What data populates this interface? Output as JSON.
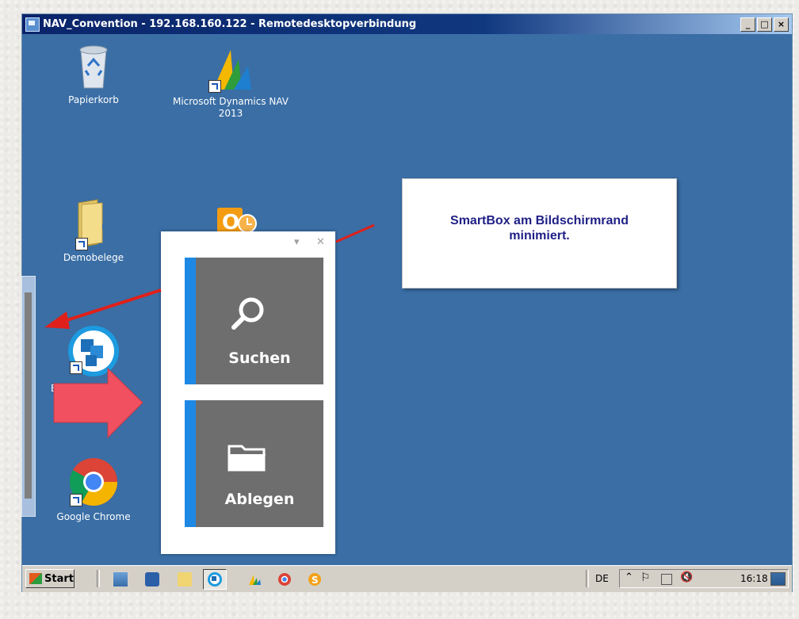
{
  "window": {
    "title": "NAV_Convention - 192.168.160.122 - Remotedesktopverbindung",
    "controls": {
      "minimize": "_",
      "maximize": "□",
      "close": "×"
    }
  },
  "desktop_icons": [
    {
      "label": "Papierkorb",
      "icon": "recycle-bin-icon"
    },
    {
      "label": "Microsoft Dynamics NAV 2013",
      "icon": "dynamics-nav-icon"
    },
    {
      "label": "Demobelege",
      "icon": "folder-icon"
    },
    {
      "label": "",
      "icon": "outlook-icon"
    },
    {
      "label": "EC",
      "label2": "ox",
      "icon": "smartbox-app-icon"
    },
    {
      "label": "Google Chrome",
      "icon": "chrome-icon"
    }
  ],
  "smartbox": {
    "dropdown": "▾",
    "close": "✕",
    "tiles": [
      {
        "label": "Suchen",
        "icon": "search-icon"
      },
      {
        "label": "Ablegen",
        "icon": "folder-icon"
      }
    ]
  },
  "callout": {
    "line1": "SmartBox am Bildschirmrand",
    "line2": "minimiert."
  },
  "taskbar": {
    "start_label": "Start",
    "language": "DE",
    "clock": "16:18",
    "quicklaunch": [
      "server-manager-icon",
      "powershell-icon",
      "explorer-icon",
      "smartbox-icon",
      "dynamics-nav-icon",
      "chrome-icon",
      "skype-icon"
    ]
  },
  "colors": {
    "desktop": "#3a6ea5",
    "tile": "#6e6e6e",
    "tile_accent": "#1e88e5",
    "callout_text": "#1f1f86",
    "arrow_red": "#e0201a",
    "big_arrow": "#f0505f"
  }
}
